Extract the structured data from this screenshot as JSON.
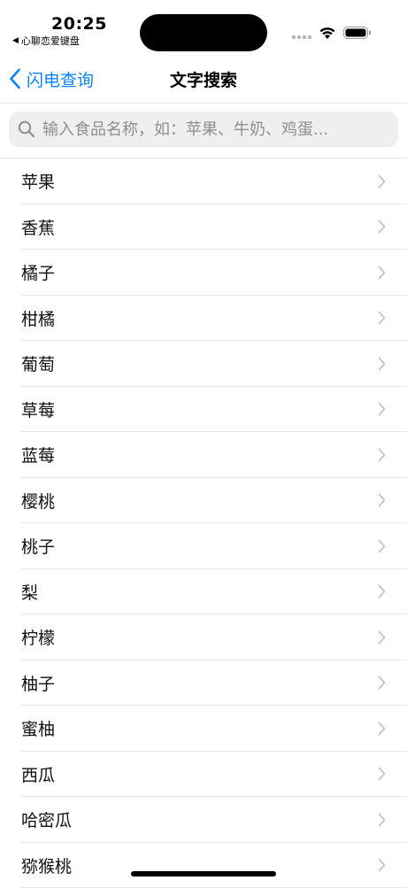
{
  "status_bar": {
    "time": "20:25",
    "back_app": "心聊恋爱键盘"
  },
  "nav": {
    "back_label": "闪电查询",
    "title": "文字搜索"
  },
  "search": {
    "placeholder": "输入食品名称，如：苹果、牛奶、鸡蛋...",
    "value": ""
  },
  "items": [
    {
      "label": "苹果"
    },
    {
      "label": "香蕉"
    },
    {
      "label": "橘子"
    },
    {
      "label": "柑橘"
    },
    {
      "label": "葡萄"
    },
    {
      "label": "草莓"
    },
    {
      "label": "蓝莓"
    },
    {
      "label": "樱桃"
    },
    {
      "label": "桃子"
    },
    {
      "label": "梨"
    },
    {
      "label": "柠檬"
    },
    {
      "label": "柚子"
    },
    {
      "label": "蜜柚"
    },
    {
      "label": "西瓜"
    },
    {
      "label": "哈密瓜"
    },
    {
      "label": "猕猴桃"
    }
  ],
  "colors": {
    "accent": "#0a84ff",
    "search_bg": "#efeff0",
    "separator": "#e6e6e6",
    "chevron": "#c4c4c7"
  },
  "icons": {
    "back": "chevron-left-icon",
    "search": "magnifier-icon",
    "row": "chevron-right-icon",
    "wifi": "wifi-icon",
    "battery": "battery-icon"
  }
}
